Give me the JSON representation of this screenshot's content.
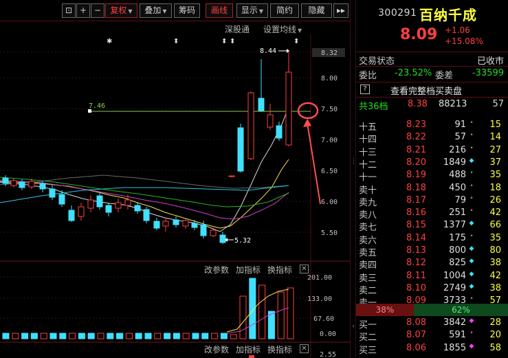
{
  "toolbar": {
    "square_btn": "⊡",
    "plus_btn": "+",
    "minus_btn": "−",
    "fuquan": "复权",
    "diejia": "叠加",
    "chouma": "筹码",
    "huaxian": "画线",
    "xianshi": "显示",
    "jianyue": "简约",
    "yincang": "隐藏",
    "expand": "▸▸"
  },
  "subbar": {
    "exchange": "深股通",
    "ma_setting": "设置均线"
  },
  "main_chart": {
    "y_ticks": [
      "8.32",
      "8.00",
      "7.50",
      "7.00",
      "6.50",
      "6.00",
      "5.50"
    ],
    "high_label": "8.44",
    "low_label": "5.32",
    "hline_label": "7.46",
    "markers": [
      "✱",
      "⬍",
      "⬍",
      "⬍",
      "⬍"
    ]
  },
  "volume_panel": {
    "labels": [
      "改参数",
      "加指标",
      "换指标"
    ],
    "y_ticks": [
      "201.00",
      "133.00",
      "67.60",
      "0.00"
    ]
  },
  "bottom_panel": {
    "labels": [
      "改参数",
      "加指标",
      "换指标"
    ],
    "y_tick": "2.55"
  },
  "quote": {
    "code": "300291",
    "name": "百纳千成",
    "price": "8.09",
    "change": "+1.06",
    "change_pct": "+15.08%",
    "status_label": "交易状态",
    "status_value": "已收市",
    "weibi_label": "委比",
    "weibi_value": "-23.52%",
    "weicha_label": "委差",
    "weicha_value": "-33599",
    "full_book_icon": "?",
    "full_book_link": "查看完整档买卖盘",
    "total_levels": "共36档",
    "total_price": "8.38",
    "total_volume": "88213",
    "total_count": "57"
  },
  "order_book": {
    "asks": [
      {
        "level": "十五",
        "price": "8.23",
        "volume": "91",
        "dot": "grey",
        "count": "15"
      },
      {
        "level": "十四",
        "price": "8.22",
        "volume": "57",
        "dot": "grey",
        "count": "14"
      },
      {
        "level": "十三",
        "price": "8.21",
        "volume": "216",
        "dot": "grey",
        "count": "27"
      },
      {
        "level": "十二",
        "price": "8.20",
        "volume": "1849",
        "dot": "cyan",
        "count": "37"
      },
      {
        "level": "十一",
        "price": "8.19",
        "volume": "488",
        "dot": "grey",
        "count": "35"
      },
      {
        "level": "卖十",
        "price": "8.18",
        "volume": "450",
        "dot": "grey",
        "count": "18"
      },
      {
        "level": "卖九",
        "price": "8.17",
        "volume": "79",
        "dot": "grey",
        "count": "26"
      },
      {
        "level": "卖八",
        "price": "8.16",
        "volume": "251",
        "dot": "grey",
        "count": "42"
      },
      {
        "level": "卖七",
        "price": "8.15",
        "volume": "1377",
        "dot": "cyan",
        "count": "66"
      },
      {
        "level": "卖六",
        "price": "8.14",
        "volume": "175",
        "dot": "grey",
        "count": "35"
      },
      {
        "level": "卖五",
        "price": "8.13",
        "volume": "800",
        "dot": "cyan",
        "count": "80"
      },
      {
        "level": "卖四",
        "price": "8.12",
        "volume": "825",
        "dot": "cyan",
        "count": "38"
      },
      {
        "level": "卖三",
        "price": "8.11",
        "volume": "1004",
        "dot": "cyan",
        "count": "42"
      },
      {
        "level": "卖二",
        "price": "8.10",
        "volume": "2749",
        "dot": "cyan",
        "count": "38"
      },
      {
        "level": "卖一",
        "price": "8.09",
        "volume": "3733",
        "dot": "grey",
        "count": "57"
      }
    ],
    "ratio_sell": "38%",
    "ratio_buy": "62%",
    "ratio_sell_fraction": 0.38,
    "bids": [
      {
        "level": "买一",
        "price": "8.08",
        "volume": "3842",
        "dot": "magenta",
        "count": "28"
      },
      {
        "level": "买二",
        "price": "8.07",
        "volume": "591",
        "dot": "grey",
        "count": "20"
      },
      {
        "level": "买三",
        "price": "8.06",
        "volume": "1855",
        "dot": "magenta",
        "count": "58"
      }
    ]
  }
}
